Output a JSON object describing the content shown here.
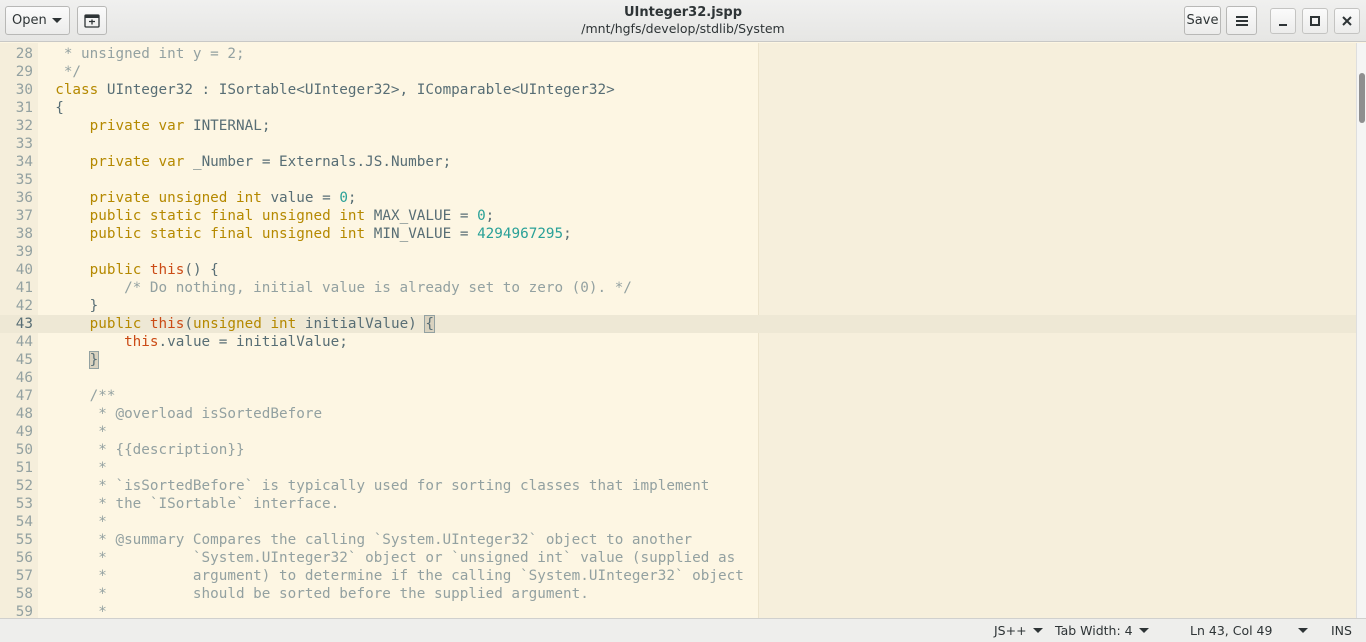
{
  "header": {
    "open_label": "Open",
    "save_label": "Save",
    "title": "UInteger32.jspp",
    "subtitle": "/mnt/hgfs/develop/stdlib/System",
    "icons": {
      "new_document": "new-document-icon",
      "menu": "hamburger-menu-icon",
      "minimize": "minimize-icon",
      "maximize": "maximize-icon",
      "close": "close-icon"
    }
  },
  "editor": {
    "current_line": "43",
    "lines": [
      {
        "n": "28",
        "t": "   * unsigned int y = 2;"
      },
      {
        "n": "29",
        "t": "   */"
      },
      {
        "n": "30",
        "t": "  class UInteger32 : ISortable<UInteger32>, IComparable<UInteger32>"
      },
      {
        "n": "31",
        "t": "  {"
      },
      {
        "n": "32",
        "t": "      private var INTERNAL;"
      },
      {
        "n": "33",
        "t": ""
      },
      {
        "n": "34",
        "t": "      private var _Number = Externals.JS.Number;"
      },
      {
        "n": "35",
        "t": ""
      },
      {
        "n": "36",
        "t": "      private unsigned int value = 0;"
      },
      {
        "n": "37",
        "t": "      public static final unsigned int MAX_VALUE = 0;"
      },
      {
        "n": "38",
        "t": "      public static final unsigned int MIN_VALUE = 4294967295;"
      },
      {
        "n": "39",
        "t": ""
      },
      {
        "n": "40",
        "t": "      public this() {"
      },
      {
        "n": "41",
        "t": "          /* Do nothing, initial value is already set to zero (0). */"
      },
      {
        "n": "42",
        "t": "      }"
      },
      {
        "n": "43",
        "t": "      public this(unsigned int initialValue) {"
      },
      {
        "n": "44",
        "t": "          this.value = initialValue;"
      },
      {
        "n": "45",
        "t": "      }"
      },
      {
        "n": "46",
        "t": ""
      },
      {
        "n": "47",
        "t": "      /**"
      },
      {
        "n": "48",
        "t": "       * @overload isSortedBefore"
      },
      {
        "n": "49",
        "t": "       *"
      },
      {
        "n": "50",
        "t": "       * {{description}}"
      },
      {
        "n": "51",
        "t": "       *"
      },
      {
        "n": "52",
        "t": "       * `isSortedBefore` is typically used for sorting classes that implement"
      },
      {
        "n": "53",
        "t": "       * the `ISortable` interface."
      },
      {
        "n": "54",
        "t": "       *"
      },
      {
        "n": "55",
        "t": "       * @summary Compares the calling `System.UInteger32` object to another"
      },
      {
        "n": "56",
        "t": "       *          `System.UInteger32` object or `unsigned int` value (supplied as"
      },
      {
        "n": "57",
        "t": "       *          argument) to determine if the calling `System.UInteger32` object"
      },
      {
        "n": "58",
        "t": "       *          should be sorted before the supplied argument."
      },
      {
        "n": "59",
        "t": "       *"
      }
    ]
  },
  "statusbar": {
    "language": "JS++",
    "tab_width": "Tab Width: 4",
    "position": "Ln 43, Col 49",
    "mode": "INS"
  },
  "colors": {
    "background": "#fdf6e3",
    "keyword": "#b58900",
    "this_keyword": "#cb4b16",
    "number": "#2aa198",
    "comment": "#93a1a1",
    "text": "#586e75"
  }
}
